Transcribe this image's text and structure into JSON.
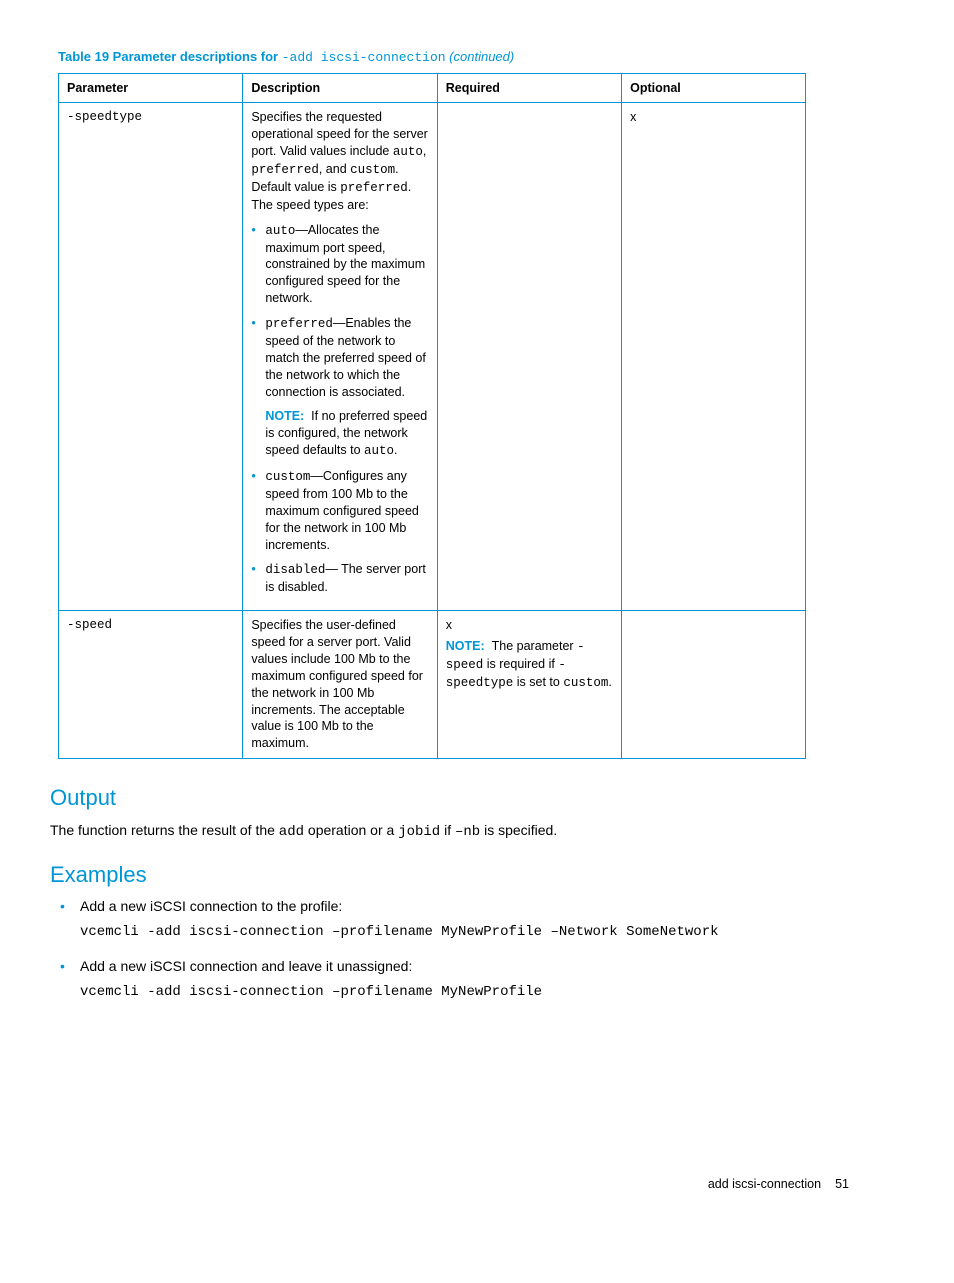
{
  "table": {
    "title_lead": "Table 19 Parameter descriptions for ",
    "title_code": "-add iscsi-connection",
    "title_cont": " (continued)",
    "headers": {
      "parameter": "Parameter",
      "description": "Description",
      "required": "Required",
      "optional": "Optional"
    },
    "rows": {
      "speedtype": {
        "param": "-speedtype",
        "desc_intro_a": "Specifies the requested operational speed for the server port. Valid values include ",
        "desc_intro_b": ", and ",
        "desc_intro_c": ". Default value is ",
        "desc_intro_d": ". The speed types are:",
        "code_auto": "auto",
        "code_preferred": "preferred",
        "code_custom": "custom",
        "li_auto_a": "—Allocates the maximum port speed, constrained by the maximum configured speed for the network.",
        "li_pref_a": "—Enables the speed of the network to match the preferred speed of the network to which the connection is associated.",
        "note_label": "NOTE:",
        "li_pref_note": "If no preferred speed is configured, the network speed defaults to ",
        "li_pref_note_end": ".",
        "li_custom_a": "—Configures any speed from 100 Mb to the maximum configured speed for the network in 100 Mb increments.",
        "code_disabled": "disabled",
        "li_disabled_a": "— The server port is disabled.",
        "optional": "x"
      },
      "speed": {
        "param": "-speed",
        "desc": "Specifies the user-defined speed for a server port. Valid values include 100 Mb to the maximum configured speed for the network in 100 Mb increments. The acceptable value is 100 Mb to the maximum.",
        "req_x": "x",
        "req_note_label": "NOTE:",
        "req_note_a": "The parameter ",
        "req_note_b": " is required if ",
        "req_note_c": " is set to ",
        "req_note_d": ".",
        "code_speed": "-speed",
        "code_speedtype": "-speedtype",
        "code_custom": "custom"
      }
    }
  },
  "output": {
    "heading": "Output",
    "text_a": "The function returns the result of the ",
    "code_add": "add",
    "text_b": " operation or a ",
    "code_jobid": "jobid",
    "text_c": " if ",
    "code_nb": "–nb",
    "text_d": " is specified."
  },
  "examples": {
    "heading": "Examples",
    "items": [
      {
        "text": "Add a new iSCSI connection to the profile:",
        "cmd": "vcemcli -add iscsi-connection –profilename MyNewProfile –Network SomeNetwork"
      },
      {
        "text": "Add a new iSCSI connection and leave it unassigned:",
        "cmd": "vcemcli -add iscsi-connection –profilename MyNewProfile"
      }
    ]
  },
  "footer": {
    "section": "add iscsi-connection",
    "page": "51"
  }
}
